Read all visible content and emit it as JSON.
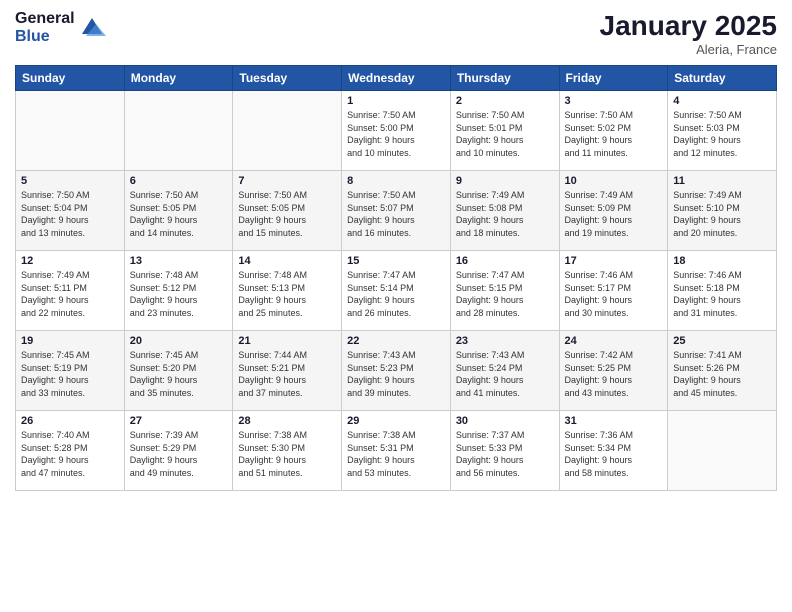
{
  "logo": {
    "line1": "General",
    "line2": "Blue"
  },
  "title": "January 2025",
  "location": "Aleria, France",
  "days_header": [
    "Sunday",
    "Monday",
    "Tuesday",
    "Wednesday",
    "Thursday",
    "Friday",
    "Saturday"
  ],
  "weeks": [
    [
      {
        "num": "",
        "info": ""
      },
      {
        "num": "",
        "info": ""
      },
      {
        "num": "",
        "info": ""
      },
      {
        "num": "1",
        "info": "Sunrise: 7:50 AM\nSunset: 5:00 PM\nDaylight: 9 hours\nand 10 minutes."
      },
      {
        "num": "2",
        "info": "Sunrise: 7:50 AM\nSunset: 5:01 PM\nDaylight: 9 hours\nand 10 minutes."
      },
      {
        "num": "3",
        "info": "Sunrise: 7:50 AM\nSunset: 5:02 PM\nDaylight: 9 hours\nand 11 minutes."
      },
      {
        "num": "4",
        "info": "Sunrise: 7:50 AM\nSunset: 5:03 PM\nDaylight: 9 hours\nand 12 minutes."
      }
    ],
    [
      {
        "num": "5",
        "info": "Sunrise: 7:50 AM\nSunset: 5:04 PM\nDaylight: 9 hours\nand 13 minutes."
      },
      {
        "num": "6",
        "info": "Sunrise: 7:50 AM\nSunset: 5:05 PM\nDaylight: 9 hours\nand 14 minutes."
      },
      {
        "num": "7",
        "info": "Sunrise: 7:50 AM\nSunset: 5:05 PM\nDaylight: 9 hours\nand 15 minutes."
      },
      {
        "num": "8",
        "info": "Sunrise: 7:50 AM\nSunset: 5:07 PM\nDaylight: 9 hours\nand 16 minutes."
      },
      {
        "num": "9",
        "info": "Sunrise: 7:49 AM\nSunset: 5:08 PM\nDaylight: 9 hours\nand 18 minutes."
      },
      {
        "num": "10",
        "info": "Sunrise: 7:49 AM\nSunset: 5:09 PM\nDaylight: 9 hours\nand 19 minutes."
      },
      {
        "num": "11",
        "info": "Sunrise: 7:49 AM\nSunset: 5:10 PM\nDaylight: 9 hours\nand 20 minutes."
      }
    ],
    [
      {
        "num": "12",
        "info": "Sunrise: 7:49 AM\nSunset: 5:11 PM\nDaylight: 9 hours\nand 22 minutes."
      },
      {
        "num": "13",
        "info": "Sunrise: 7:48 AM\nSunset: 5:12 PM\nDaylight: 9 hours\nand 23 minutes."
      },
      {
        "num": "14",
        "info": "Sunrise: 7:48 AM\nSunset: 5:13 PM\nDaylight: 9 hours\nand 25 minutes."
      },
      {
        "num": "15",
        "info": "Sunrise: 7:47 AM\nSunset: 5:14 PM\nDaylight: 9 hours\nand 26 minutes."
      },
      {
        "num": "16",
        "info": "Sunrise: 7:47 AM\nSunset: 5:15 PM\nDaylight: 9 hours\nand 28 minutes."
      },
      {
        "num": "17",
        "info": "Sunrise: 7:46 AM\nSunset: 5:17 PM\nDaylight: 9 hours\nand 30 minutes."
      },
      {
        "num": "18",
        "info": "Sunrise: 7:46 AM\nSunset: 5:18 PM\nDaylight: 9 hours\nand 31 minutes."
      }
    ],
    [
      {
        "num": "19",
        "info": "Sunrise: 7:45 AM\nSunset: 5:19 PM\nDaylight: 9 hours\nand 33 minutes."
      },
      {
        "num": "20",
        "info": "Sunrise: 7:45 AM\nSunset: 5:20 PM\nDaylight: 9 hours\nand 35 minutes."
      },
      {
        "num": "21",
        "info": "Sunrise: 7:44 AM\nSunset: 5:21 PM\nDaylight: 9 hours\nand 37 minutes."
      },
      {
        "num": "22",
        "info": "Sunrise: 7:43 AM\nSunset: 5:23 PM\nDaylight: 9 hours\nand 39 minutes."
      },
      {
        "num": "23",
        "info": "Sunrise: 7:43 AM\nSunset: 5:24 PM\nDaylight: 9 hours\nand 41 minutes."
      },
      {
        "num": "24",
        "info": "Sunrise: 7:42 AM\nSunset: 5:25 PM\nDaylight: 9 hours\nand 43 minutes."
      },
      {
        "num": "25",
        "info": "Sunrise: 7:41 AM\nSunset: 5:26 PM\nDaylight: 9 hours\nand 45 minutes."
      }
    ],
    [
      {
        "num": "26",
        "info": "Sunrise: 7:40 AM\nSunset: 5:28 PM\nDaylight: 9 hours\nand 47 minutes."
      },
      {
        "num": "27",
        "info": "Sunrise: 7:39 AM\nSunset: 5:29 PM\nDaylight: 9 hours\nand 49 minutes."
      },
      {
        "num": "28",
        "info": "Sunrise: 7:38 AM\nSunset: 5:30 PM\nDaylight: 9 hours\nand 51 minutes."
      },
      {
        "num": "29",
        "info": "Sunrise: 7:38 AM\nSunset: 5:31 PM\nDaylight: 9 hours\nand 53 minutes."
      },
      {
        "num": "30",
        "info": "Sunrise: 7:37 AM\nSunset: 5:33 PM\nDaylight: 9 hours\nand 56 minutes."
      },
      {
        "num": "31",
        "info": "Sunrise: 7:36 AM\nSunset: 5:34 PM\nDaylight: 9 hours\nand 58 minutes."
      },
      {
        "num": "",
        "info": ""
      }
    ]
  ]
}
